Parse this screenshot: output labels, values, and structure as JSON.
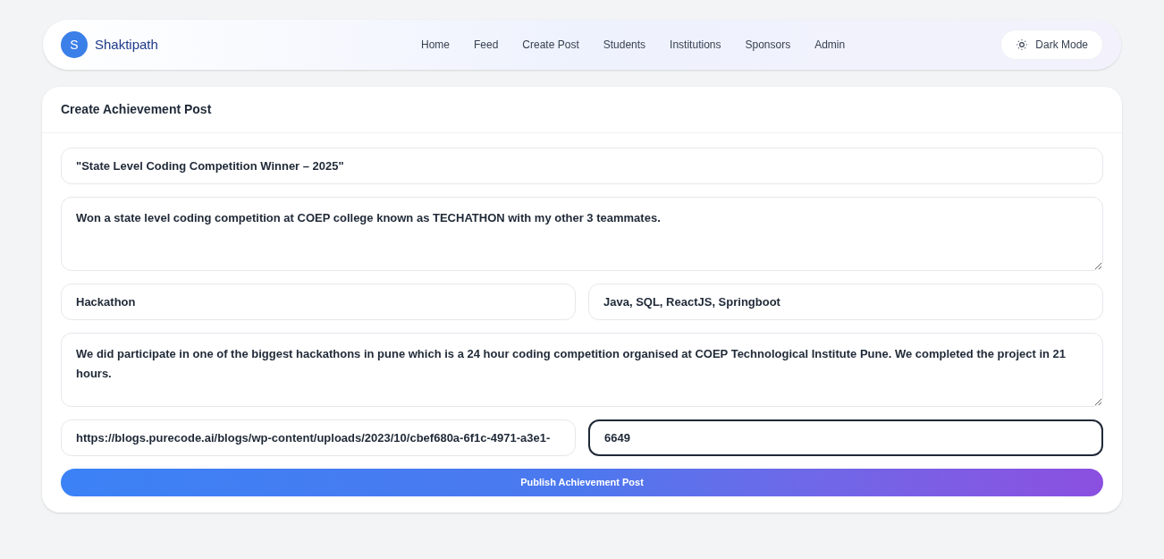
{
  "brand": {
    "initial": "S",
    "name": "Shaktipath"
  },
  "nav": [
    "Home",
    "Feed",
    "Create Post",
    "Students",
    "Institutions",
    "Sponsors",
    "Admin"
  ],
  "theme_button": "Dark Mode",
  "form": {
    "title": "Create Achievement Post",
    "title_field": {
      "value": "\"State Level Coding Competition Winner – 2025\"",
      "focused": false
    },
    "description": {
      "value": "Won a state level coding competition at COEP college known as TECHATHON with my other 3 teammates.",
      "focused": false
    },
    "row_1": [
      {
        "value": "Hackathon",
        "focused": false
      },
      {
        "value": "Java, SQL, ReactJS, Springboot",
        "focused": false
      }
    ],
    "details": {
      "value": "We did participate in one of the biggest hackathons in pune which is a 24 hour coding competition organised at COEP Technological Institute Pune. We completed the project in 21 hours.",
      "focused": false
    },
    "row_2": [
      {
        "value": "https://blogs.purecode.ai/blogs/wp-content/uploads/2023/10/cbef680a-6f1c-4971-a3e1-",
        "focused": false
      },
      {
        "value": "6649",
        "focused": true
      }
    ],
    "submit": "Publish Achievement Post"
  }
}
